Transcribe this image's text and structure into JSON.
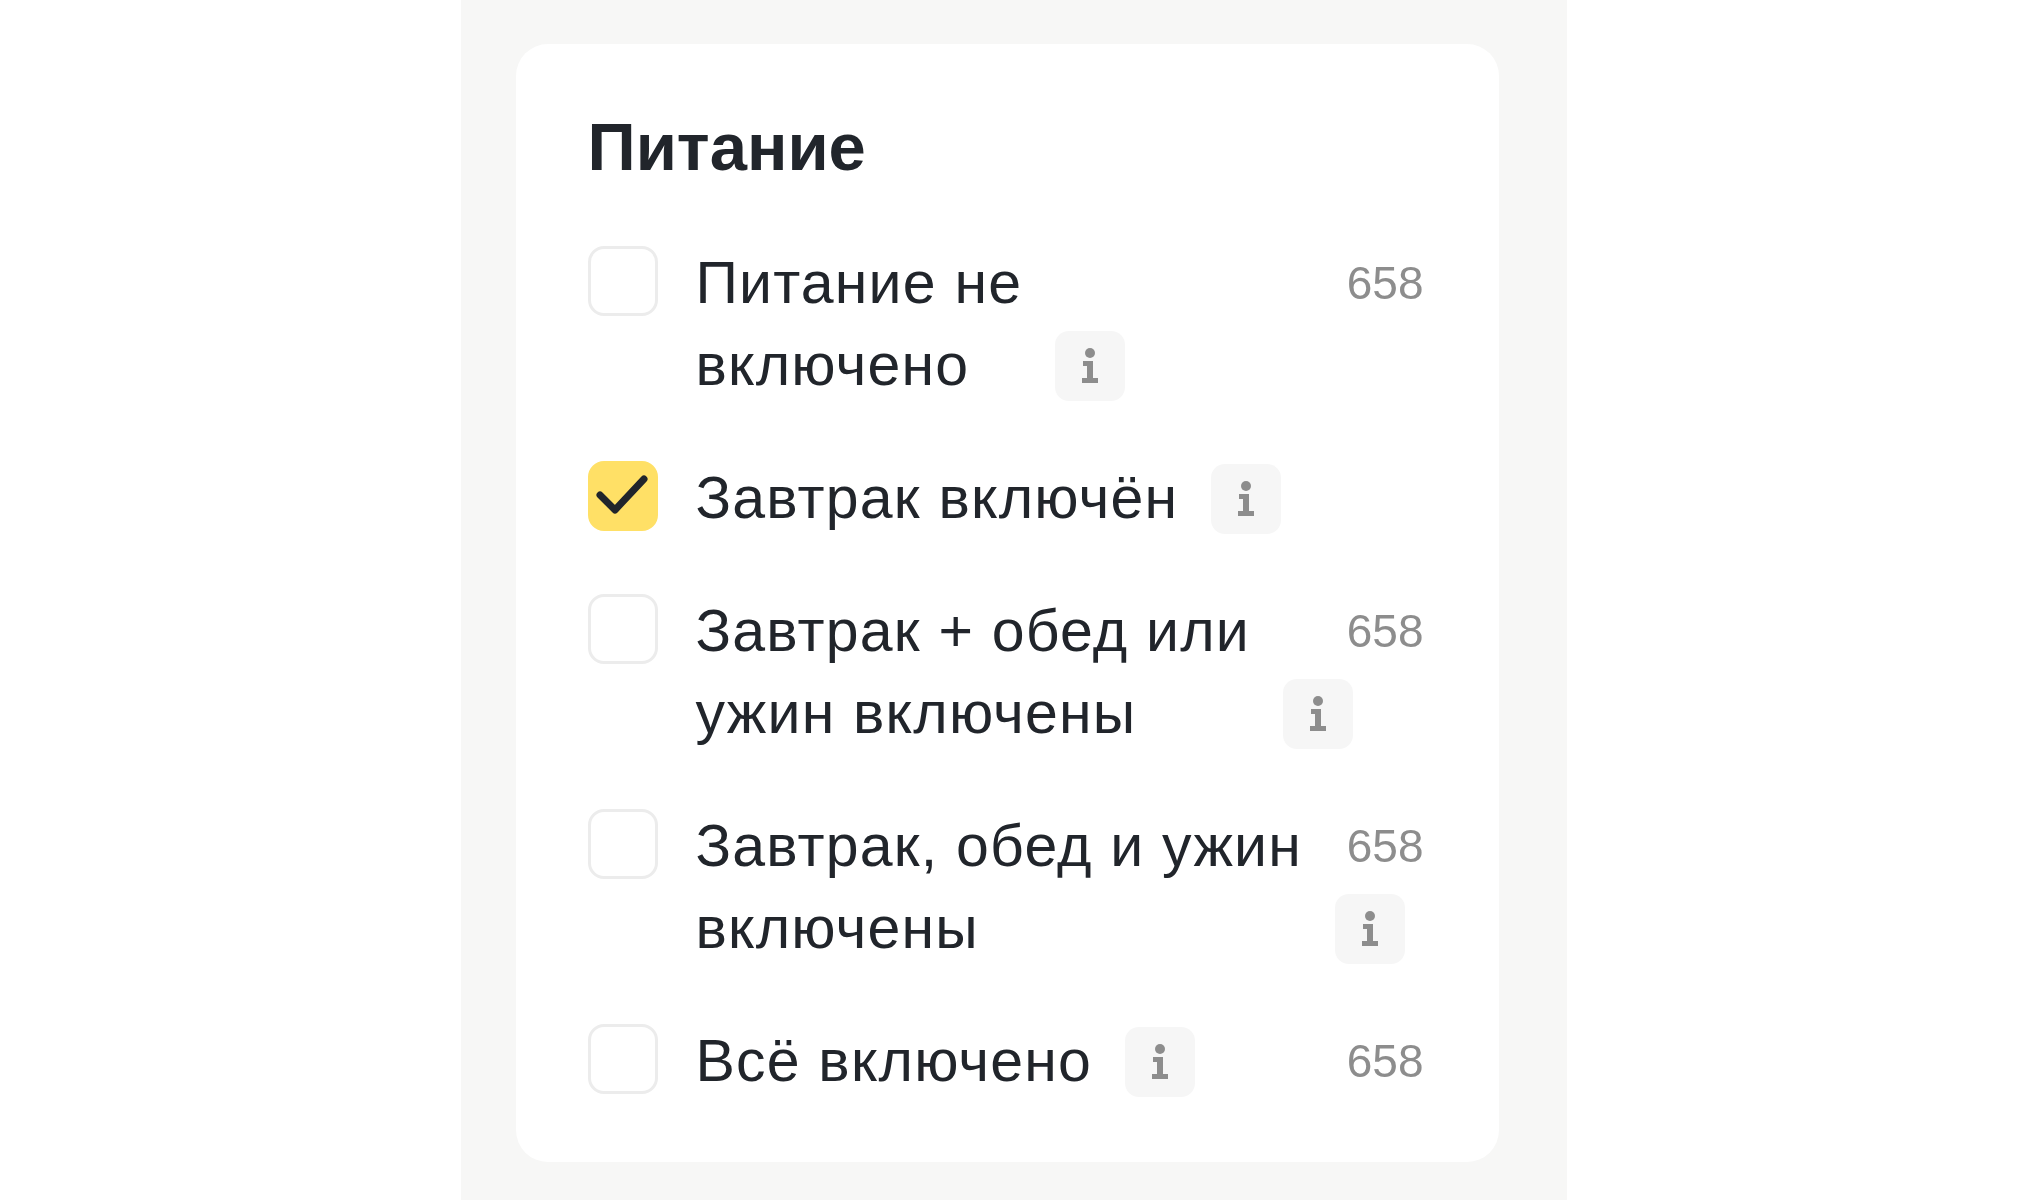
{
  "section": {
    "title": "Питание"
  },
  "options": [
    {
      "label": "Питание не включено",
      "checked": false,
      "count": "658"
    },
    {
      "label": "Завтрак включён",
      "checked": true
    },
    {
      "label": "Завтрак + обед или ужин включены",
      "checked": false,
      "count": "658"
    },
    {
      "label": "Завтрак, обед и ужин включены",
      "checked": false,
      "count": "658"
    },
    {
      "label": "Всё включено",
      "checked": false,
      "count": "658"
    }
  ]
}
